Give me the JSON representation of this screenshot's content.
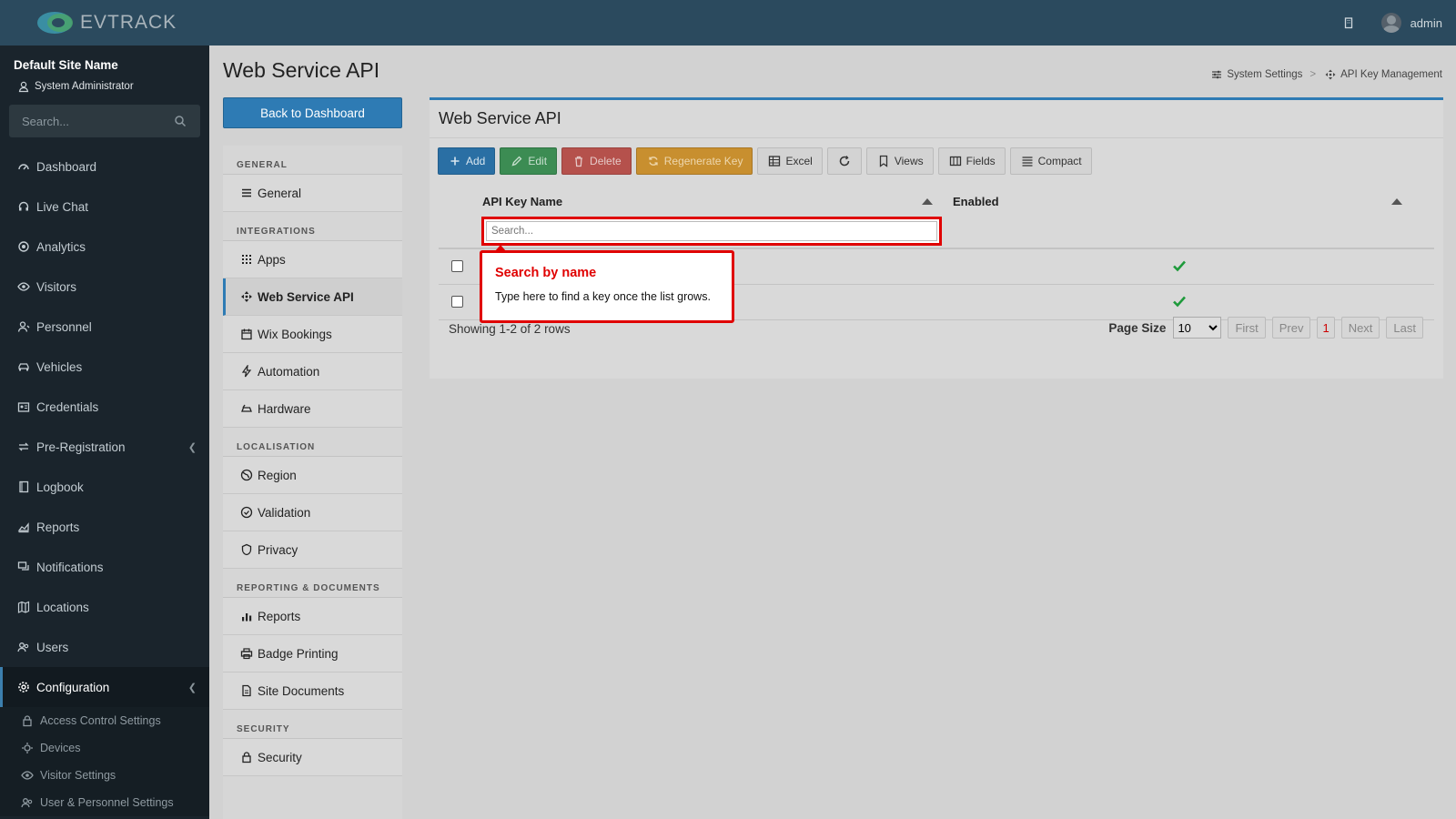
{
  "app": {
    "name": "EVTRACK",
    "user": "admin"
  },
  "site": {
    "name": "Default Site Name",
    "role": "System Administrator"
  },
  "sidebar": {
    "search_placeholder": "Search...",
    "items": [
      {
        "label": "Dashboard",
        "icon": "gauge-icon"
      },
      {
        "label": "Live Chat",
        "icon": "headset-icon"
      },
      {
        "label": "Analytics",
        "icon": "target-icon"
      },
      {
        "label": "Visitors",
        "icon": "eye-icon"
      },
      {
        "label": "Personnel",
        "icon": "user-tie-icon"
      },
      {
        "label": "Vehicles",
        "icon": "car-icon"
      },
      {
        "label": "Credentials",
        "icon": "id-card-icon"
      },
      {
        "label": "Pre-Registration",
        "icon": "exchange-icon"
      },
      {
        "label": "Logbook",
        "icon": "book-icon"
      },
      {
        "label": "Reports",
        "icon": "chart-area-icon"
      },
      {
        "label": "Notifications",
        "icon": "comments-icon"
      },
      {
        "label": "Locations",
        "icon": "map-icon"
      },
      {
        "label": "Users",
        "icon": "users-icon"
      },
      {
        "label": "Configuration",
        "icon": "cog-icon"
      }
    ],
    "sub_items": [
      {
        "label": "Access Control Settings",
        "icon": "lock-icon"
      },
      {
        "label": "Devices",
        "icon": "devices-icon"
      },
      {
        "label": "Visitor Settings",
        "icon": "eye-icon"
      },
      {
        "label": "User & Personnel Settings",
        "icon": "users-icon"
      }
    ]
  },
  "page": {
    "title": "Web Service API",
    "breadcrumb": [
      "System Settings",
      "API Key Management"
    ],
    "breadcrumb_sep": ">",
    "back_button": "Back to Dashboard"
  },
  "settings_menu": {
    "sections": [
      {
        "heading": "GENERAL",
        "items": [
          {
            "label": "General",
            "icon": "list-icon"
          }
        ]
      },
      {
        "heading": "INTEGRATIONS",
        "items": [
          {
            "label": "Apps",
            "icon": "grid-icon"
          },
          {
            "label": "Web Service API",
            "icon": "arrows-icon"
          },
          {
            "label": "Wix Bookings",
            "icon": "calendar-icon"
          },
          {
            "label": "Automation",
            "icon": "bolt-icon"
          },
          {
            "label": "Hardware",
            "icon": "hardware-icon"
          }
        ]
      },
      {
        "heading": "LOCALISATION",
        "items": [
          {
            "label": "Region",
            "icon": "globe-icon"
          },
          {
            "label": "Validation",
            "icon": "check-circle-icon"
          },
          {
            "label": "Privacy",
            "icon": "shield-icon"
          }
        ]
      },
      {
        "heading": "REPORTING & DOCUMENTS",
        "items": [
          {
            "label": "Reports",
            "icon": "bar-chart-icon"
          },
          {
            "label": "Badge Printing",
            "icon": "printer-icon"
          },
          {
            "label": "Site Documents",
            "icon": "file-icon"
          }
        ]
      },
      {
        "heading": "SECURITY",
        "items": [
          {
            "label": "Security",
            "icon": "lock-icon"
          }
        ]
      }
    ]
  },
  "panel": {
    "title": "Web Service API",
    "toolbar": {
      "add": "Add",
      "edit": "Edit",
      "delete": "Delete",
      "regenerate": "Regenerate Key",
      "excel": "Excel",
      "views": "Views",
      "fields": "Fields",
      "compact": "Compact"
    },
    "columns": [
      "API Key Name",
      "Enabled"
    ],
    "search_placeholder": "Search...",
    "rows": [
      {
        "name": "",
        "enabled": true
      },
      {
        "name": "",
        "enabled": true
      }
    ],
    "pager": {
      "info": "Showing 1-2 of 2 rows",
      "page_size_label": "Page Size",
      "page_size": "10",
      "first": "First",
      "prev": "Prev",
      "current": "1",
      "next": "Next",
      "last": "Last"
    }
  },
  "tooltip": {
    "title": "Search by name",
    "body": "Type here to find a key once the list grows."
  },
  "colors": {
    "accent": "#2e7bb4",
    "highlight": "#e00000",
    "enabled_check": "#1e9a3b"
  }
}
